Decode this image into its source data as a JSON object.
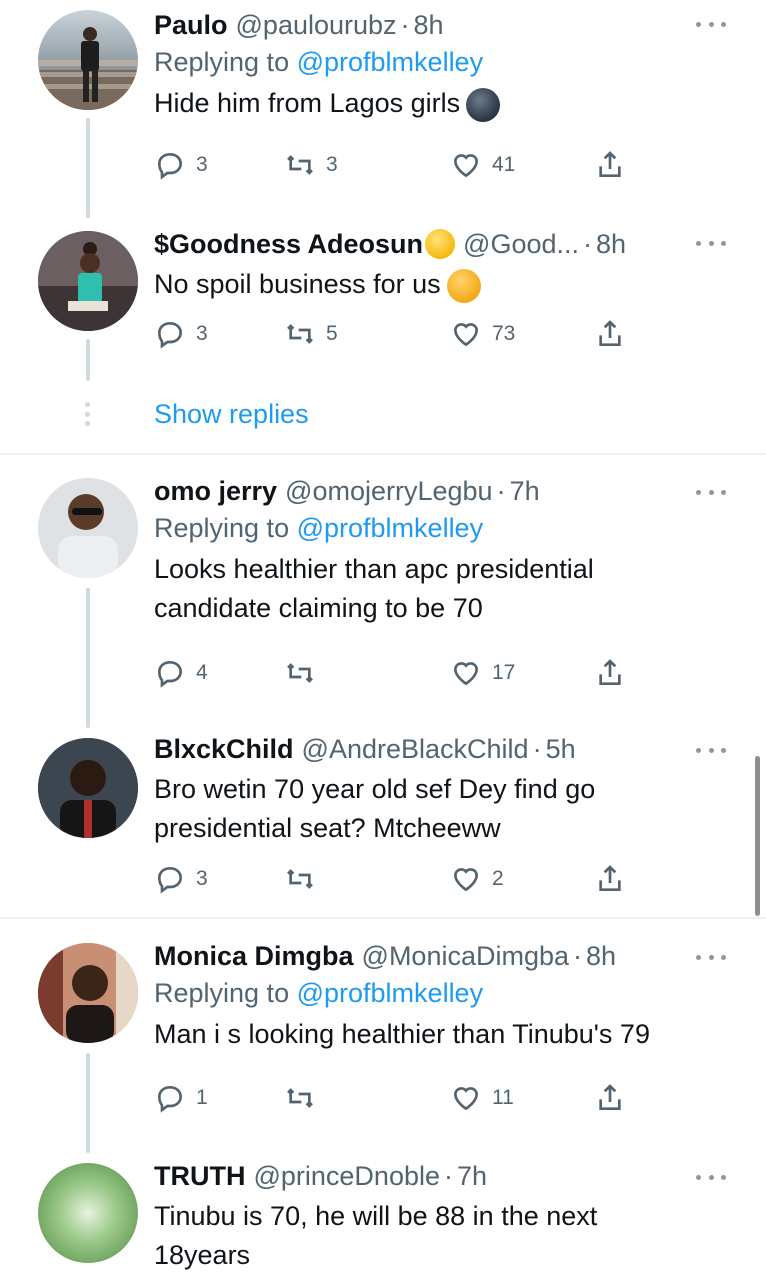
{
  "tweets": [
    {
      "name": "Paulo",
      "handle": "@paulourubz",
      "time": "8h",
      "replying_prefix": "Replying to",
      "replying_to": "@profblmkelley",
      "text": "Hide him from Lagos girls",
      "replies": "3",
      "retweets": "3",
      "likes": "41",
      "emoji": "new-moon-face"
    },
    {
      "name": "$Goodness Adeosun",
      "handle": "@Good...",
      "time": "8h",
      "text": "No spoil business for us",
      "replies": "3",
      "retweets": "5",
      "likes": "73",
      "emoji": "unamused-face"
    },
    {
      "name": "omo jerry",
      "handle": "@omojerryLegbu",
      "time": "7h",
      "replying_prefix": "Replying to",
      "replying_to": "@profblmkelley",
      "text_line1": "Looks healthier than apc presidential",
      "text_line2": "candidate claiming to be 70",
      "replies": "4",
      "retweets": "",
      "likes": "17"
    },
    {
      "name": "BlxckChild",
      "handle": "@AndreBlackChild",
      "time": "5h",
      "text_line1": "Bro wetin 70 year old sef Dey find go",
      "text_line2": "presidential seat? Mtcheeww",
      "replies": "3",
      "retweets": "",
      "likes": "2"
    },
    {
      "name": "Monica Dimgba",
      "handle": "@MonicaDimgba",
      "time": "8h",
      "replying_prefix": "Replying to",
      "replying_to": "@profblmkelley",
      "text": "Man i s looking healthier than Tinubu's 79",
      "replies": "1",
      "retweets": "",
      "likes": "11"
    },
    {
      "name": "TRUTH",
      "handle": "@princeDnoble",
      "time": "7h",
      "text_line1": "Tinubu is 70, he will be 88 in the next",
      "text_line2": "18years"
    }
  ],
  "show_replies": "Show replies",
  "separator": "·",
  "colors": {
    "link": "#1d9bf0",
    "secondary": "#536471",
    "text": "#0f1419"
  }
}
